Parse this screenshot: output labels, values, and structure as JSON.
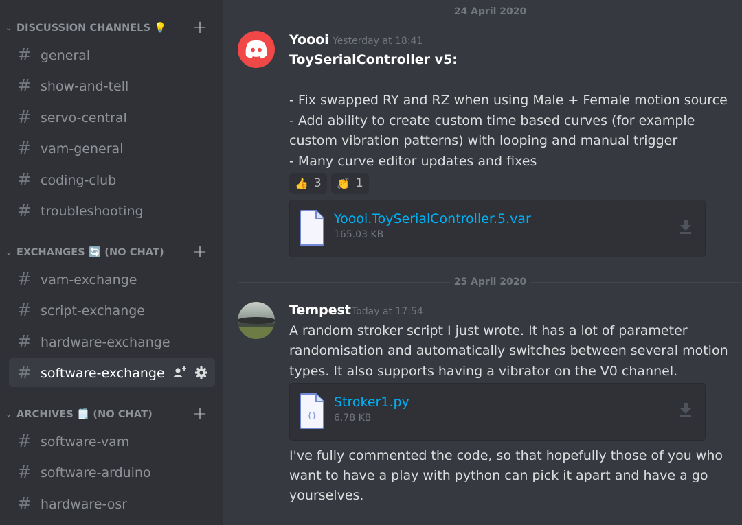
{
  "sidebar": {
    "categories": [
      {
        "label": "DISCUSSION CHANNELS 💡"
      },
      {
        "label": "EXCHANGES 🔄 (NO CHAT)"
      },
      {
        "label": "ARCHIVES 🗒️ (NO CHAT)"
      }
    ],
    "channels": [
      {
        "name": "general"
      },
      {
        "name": "show-and-tell"
      },
      {
        "name": "servo-central"
      },
      {
        "name": "vam-general"
      },
      {
        "name": "coding-club"
      },
      {
        "name": "troubleshooting"
      },
      {
        "name": "vam-exchange"
      },
      {
        "name": "script-exchange"
      },
      {
        "name": "hardware-exchange"
      },
      {
        "name": "software-exchange"
      },
      {
        "name": "software-vam"
      },
      {
        "name": "software-arduino"
      },
      {
        "name": "hardware-osr"
      }
    ],
    "add_icon": "+",
    "hash_icon": "#",
    "active_channel": "software-exchange"
  },
  "messages": [
    {
      "date_divider": "24 April 2020",
      "username": "Yoooi",
      "timestamp": "Yesterday at 18:41",
      "avatar": "discord-logo-icon",
      "avatar_color": "#f04747",
      "lines": [
        "ToySerialController v5:",
        "- Fix swapped RY and RZ when using Male + Female motion source",
        "- Add ability to create custom time based curves (for example",
        "custom vibration patterns) with looping and manual trigger",
        "- Many curve editor updates and fixes"
      ],
      "reactions": [
        {
          "emoji": "👍",
          "count": "3"
        },
        {
          "emoji": "👏",
          "count": "1"
        }
      ],
      "attachment": {
        "name": "Yoooi.ToySerialController.5.var",
        "size": "165.03 KB",
        "icon": "file-icon"
      }
    },
    {
      "date_divider": "25 April 2020",
      "username": "Tempest",
      "timestamp": "Today at 17:54",
      "avatar": "storm-photo-avatar",
      "lines": [
        "A random stroker script I just wrote. It has a lot of parameter",
        "randomisation and automatically switches between several motion",
        "types. It also supports having a vibrator on the V0 channel."
      ],
      "attachment": {
        "name": "Stroker1.py",
        "size": "6.78 KB",
        "icon": "code-file-icon",
        "icon_glyph": "{}"
      },
      "followup_lines": [
        "I've fully commented the code, so that hopefully those of you who",
        "want to have a play with python can pick it apart and have a go",
        "yourselves."
      ]
    }
  ],
  "colors": {
    "sidebar_bg": "#2f3136",
    "chat_bg": "#36393f",
    "link": "#00b0f4",
    "muted": "#72767d"
  }
}
